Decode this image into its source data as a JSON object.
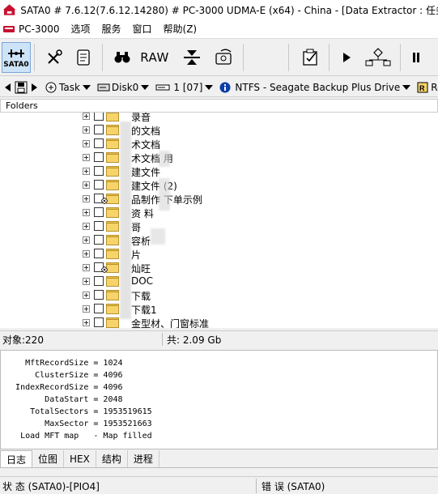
{
  "window": {
    "title": "SATA0 # 7.6.12(7.6.12.14280) # PC-3000 UDMA-E (x64) - China - [Data Extractor : 任务 - \""
  },
  "menu": {
    "items": [
      "PC-3000",
      "选项",
      "服务",
      "窗口",
      "帮助(Z)"
    ]
  },
  "toolbar": {
    "sata_label": "SATA0",
    "raw_label": "RAW",
    "buttons": [
      "sata0-port",
      "tools",
      "scroll",
      "binoculars",
      "raw",
      "merge",
      "disk-scan",
      "export",
      "play",
      "tree",
      "pause"
    ]
  },
  "pathbar": {
    "task_label": "Task",
    "disk_label": "Disk0",
    "partition_label": "1 [07]",
    "fs_label": "NTFS - Seagate Backup Plus Drive",
    "root_label": "Roo"
  },
  "folders_header": "Folders",
  "tree": {
    "items": [
      {
        "name": "录音",
        "linked": false
      },
      {
        "name": "的文档",
        "linked": false
      },
      {
        "name": "术文档",
        "linked": false
      },
      {
        "name": "术文档       用",
        "linked": false
      },
      {
        "name": "建文件",
        "linked": false
      },
      {
        "name": "建文件     (2)",
        "linked": false
      },
      {
        "name": "品制作     下单示例",
        "linked": true
      },
      {
        "name": "                  资         料",
        "linked": false
      },
      {
        "name": "哥",
        "linked": false
      },
      {
        "name": "容析",
        "linked": false
      },
      {
        "name": "片",
        "linked": false
      },
      {
        "name": "灿旺",
        "linked": true
      },
      {
        "name": "DOC",
        "linked": false
      },
      {
        "name": "下载",
        "linked": false
      },
      {
        "name": "下载1",
        "linked": false
      },
      {
        "name": "金型材、门窗标准",
        "linked": false
      }
    ]
  },
  "status": {
    "objects": "对象:220",
    "total": "共: 2.09 Gb"
  },
  "log": {
    "lines": [
      "     MftRecordSize = 1024",
      "       ClusterSize = 4096",
      "   IndexRecordSize = 4096",
      "         DataStart = 2048",
      "      TotalSectors = 1953519615",
      "         MaxSector = 1953521663",
      "    Load MFT map   - Map filled"
    ]
  },
  "tabs": [
    "日志",
    "位图",
    "HEX",
    "结构",
    "进程"
  ],
  "statusbar": {
    "state": "状 态 (SATA0)-[PIO4]",
    "error": "错 误 (SATA0)"
  }
}
